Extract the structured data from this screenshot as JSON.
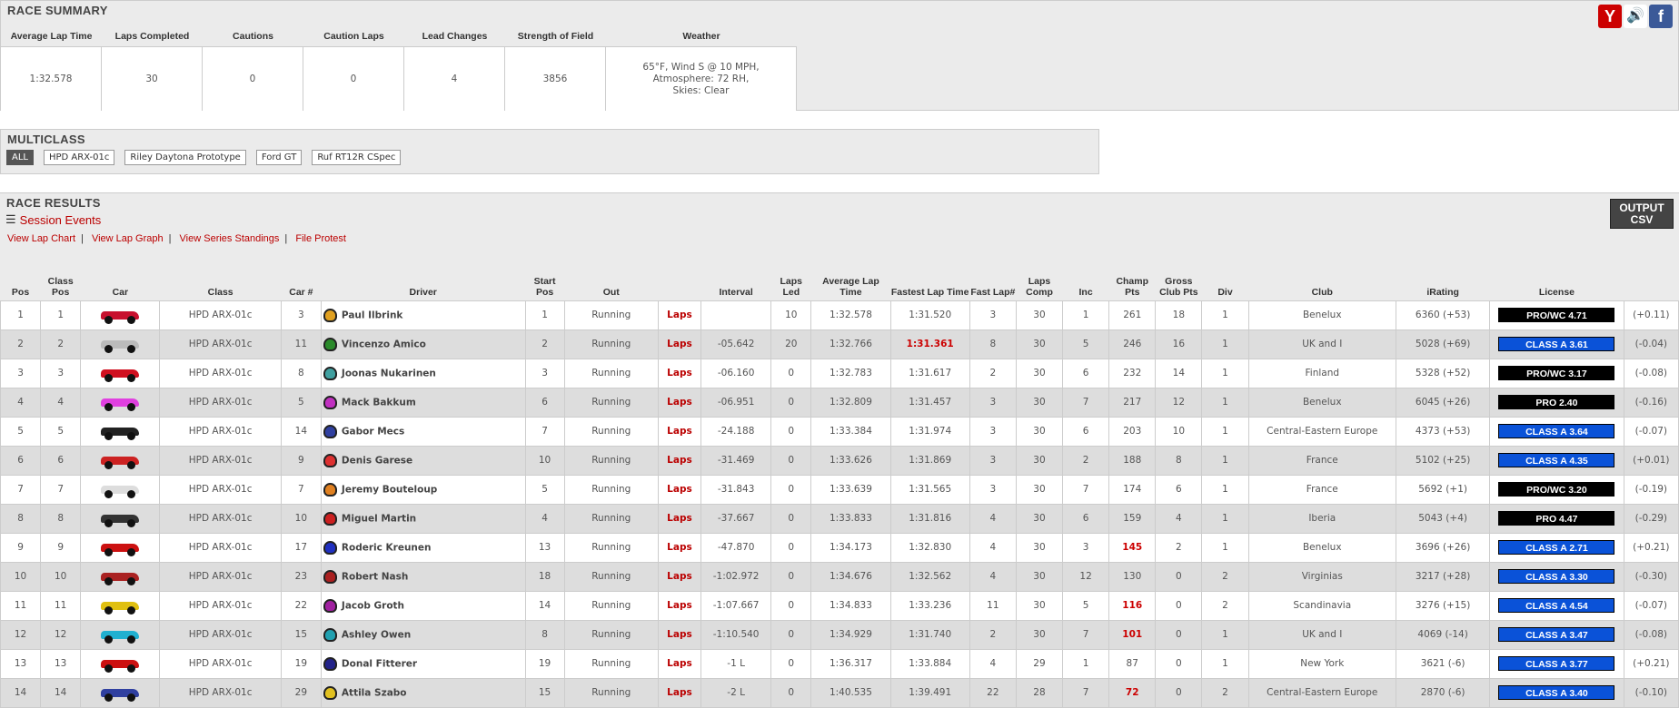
{
  "summary": {
    "title": "RACE SUMMARY",
    "headers": [
      "Average Lap Time",
      "Laps Completed",
      "Cautions",
      "Caution Laps",
      "Lead Changes",
      "Strength of Field",
      "Weather"
    ],
    "values": [
      "1:32.578",
      "30",
      "0",
      "0",
      "4",
      "3856"
    ],
    "weather": [
      "65°F, Wind S @ 10 MPH,",
      "Atmosphere: 72 RH,",
      "Skies: Clear"
    ]
  },
  "social": [
    {
      "icon": "y-icon",
      "glyph": "Y",
      "color": "#c00"
    },
    {
      "icon": "speaker-icon",
      "glyph": "🔊",
      "color": "#8899bb"
    },
    {
      "icon": "facebook-icon",
      "glyph": "f",
      "color": "#3b5998"
    }
  ],
  "multiclass": {
    "title": "MULTICLASS",
    "buttons": [
      "ALL",
      "HPD ARX-01c",
      "Riley Daytona Prototype",
      "Ford GT",
      "Ruf RT12R CSpec"
    ]
  },
  "results": {
    "title": "RACE RESULTS",
    "session_events": "Session Events",
    "links": [
      "View Lap Chart",
      "View Lap Graph",
      "View Series Standings",
      "File Protest"
    ],
    "csv_label": "OUTPUT CSV",
    "columns": [
      "Pos",
      "Class Pos",
      "Car",
      "Class",
      "Car #",
      "Driver",
      "Start Pos",
      "Out",
      "",
      "Interval",
      "Laps Led",
      "Average Lap Time",
      "Fastest Lap Time",
      "Fast Lap#",
      "Laps Comp",
      "Inc",
      "Champ Pts",
      "Gross Club Pts",
      "Div",
      "Club",
      "iRating",
      "License",
      ""
    ],
    "rows": [
      {
        "pos": "1",
        "cpos": "1",
        "cls": "HPD ARX-01c",
        "num": "3",
        "driver": "Paul Ilbrink",
        "start": "1",
        "out": "Running",
        "laps": "Laps",
        "interval": "",
        "led": "10",
        "avg": "1:32.578",
        "fast": "1:31.520",
        "fastlap": "3",
        "comp": "30",
        "inc": "1",
        "champ": "261",
        "club_pts": "18",
        "div": "1",
        "club": "Benelux",
        "irating": "6360 (+53)",
        "license": "PRO/WC 4.71",
        "lic_color": "#000",
        "sr": "(+0.11)",
        "car_color": "#c8102e",
        "helm": "#e0a020"
      },
      {
        "pos": "2",
        "cpos": "2",
        "cls": "HPD ARX-01c",
        "num": "11",
        "driver": "Vincenzo Amico",
        "start": "2",
        "out": "Running",
        "laps": "Laps",
        "interval": "-05.642",
        "led": "20",
        "avg": "1:32.766",
        "fast": "1:31.361",
        "fastlap": "8",
        "comp": "30",
        "inc": "5",
        "champ": "246",
        "club_pts": "16",
        "div": "1",
        "club": "UK and I",
        "irating": "5028 (+69)",
        "license": "CLASS A 3.61",
        "lic_color": "#0a52d8",
        "sr": "(-0.04)",
        "car_color": "#bbbbbb",
        "helm": "#2a8a2a"
      },
      {
        "pos": "3",
        "cpos": "3",
        "cls": "HPD ARX-01c",
        "num": "8",
        "driver": "Joonas Nukarinen",
        "start": "3",
        "out": "Running",
        "laps": "Laps",
        "interval": "-06.160",
        "led": "0",
        "avg": "1:32.783",
        "fast": "1:31.617",
        "fastlap": "2",
        "comp": "30",
        "inc": "6",
        "champ": "232",
        "club_pts": "14",
        "div": "1",
        "club": "Finland",
        "irating": "5328 (+52)",
        "license": "PRO/WC 3.17",
        "lic_color": "#000",
        "sr": "(-0.08)",
        "car_color": "#d01020",
        "helm": "#40a0a0"
      },
      {
        "pos": "4",
        "cpos": "4",
        "cls": "HPD ARX-01c",
        "num": "5",
        "driver": "Mack Bakkum",
        "start": "6",
        "out": "Running",
        "laps": "Laps",
        "interval": "-06.951",
        "led": "0",
        "avg": "1:32.809",
        "fast": "1:31.457",
        "fastlap": "3",
        "comp": "30",
        "inc": "7",
        "champ": "217",
        "club_pts": "12",
        "div": "1",
        "club": "Benelux",
        "irating": "6045 (+26)",
        "license": "PRO 2.40",
        "lic_color": "#000",
        "sr": "(-0.16)",
        "car_color": "#e040e0",
        "helm": "#c030c0"
      },
      {
        "pos": "5",
        "cpos": "5",
        "cls": "HPD ARX-01c",
        "num": "14",
        "driver": "Gabor Mecs",
        "start": "7",
        "out": "Running",
        "laps": "Laps",
        "interval": "-24.188",
        "led": "0",
        "avg": "1:33.384",
        "fast": "1:31.974",
        "fastlap": "3",
        "comp": "30",
        "inc": "6",
        "champ": "203",
        "club_pts": "10",
        "div": "1",
        "club": "Central-Eastern Europe",
        "irating": "4373 (+53)",
        "license": "CLASS A 3.64",
        "lic_color": "#0a52d8",
        "sr": "(-0.07)",
        "car_color": "#222222",
        "helm": "#3040a0"
      },
      {
        "pos": "6",
        "cpos": "6",
        "cls": "HPD ARX-01c",
        "num": "9",
        "driver": "Denis Garese",
        "start": "10",
        "out": "Running",
        "laps": "Laps",
        "interval": "-31.469",
        "led": "0",
        "avg": "1:33.626",
        "fast": "1:31.869",
        "fastlap": "3",
        "comp": "30",
        "inc": "2",
        "champ": "188",
        "club_pts": "8",
        "div": "1",
        "club": "France",
        "irating": "5102 (+25)",
        "license": "CLASS A 4.35",
        "lic_color": "#0a52d8",
        "sr": "(+0.01)",
        "car_color": "#cc2222",
        "helm": "#dd3030"
      },
      {
        "pos": "7",
        "cpos": "7",
        "cls": "HPD ARX-01c",
        "num": "7",
        "driver": "Jeremy Bouteloup",
        "start": "5",
        "out": "Running",
        "laps": "Laps",
        "interval": "-31.843",
        "led": "0",
        "avg": "1:33.639",
        "fast": "1:31.565",
        "fastlap": "3",
        "comp": "30",
        "inc": "7",
        "champ": "174",
        "club_pts": "6",
        "div": "1",
        "club": "France",
        "irating": "5692 (+1)",
        "license": "PRO/WC 3.20",
        "lic_color": "#000",
        "sr": "(-0.19)",
        "car_color": "#dddddd",
        "helm": "#e08020"
      },
      {
        "pos": "8",
        "cpos": "8",
        "cls": "HPD ARX-01c",
        "num": "10",
        "driver": "Miguel Martin",
        "start": "4",
        "out": "Running",
        "laps": "Laps",
        "interval": "-37.667",
        "led": "0",
        "avg": "1:33.833",
        "fast": "1:31.816",
        "fastlap": "4",
        "comp": "30",
        "inc": "6",
        "champ": "159",
        "club_pts": "4",
        "div": "1",
        "club": "Iberia",
        "irating": "5043 (+4)",
        "license": "PRO 4.47",
        "lic_color": "#000",
        "sr": "(-0.29)",
        "car_color": "#333333",
        "helm": "#cc2020"
      },
      {
        "pos": "9",
        "cpos": "9",
        "cls": "HPD ARX-01c",
        "num": "17",
        "driver": "Roderic Kreunen",
        "start": "13",
        "out": "Running",
        "laps": "Laps",
        "interval": "-47.870",
        "led": "0",
        "avg": "1:34.173",
        "fast": "1:32.830",
        "fastlap": "4",
        "comp": "30",
        "inc": "3",
        "champ": "145",
        "club_pts": "2",
        "div": "1",
        "club": "Benelux",
        "irating": "3696 (+26)",
        "license": "CLASS A 2.71",
        "lic_color": "#0a52d8",
        "sr": "(+0.21)",
        "car_color": "#cc1111",
        "helm": "#2030c0"
      },
      {
        "pos": "10",
        "cpos": "10",
        "cls": "HPD ARX-01c",
        "num": "23",
        "driver": "Robert Nash",
        "start": "18",
        "out": "Running",
        "laps": "Laps",
        "interval": "-1:02.972",
        "led": "0",
        "avg": "1:34.676",
        "fast": "1:32.562",
        "fastlap": "4",
        "comp": "30",
        "inc": "12",
        "champ": "130",
        "club_pts": "0",
        "div": "2",
        "club": "Virginias",
        "irating": "3217 (+28)",
        "license": "CLASS A 3.30",
        "lic_color": "#0a52d8",
        "sr": "(-0.30)",
        "car_color": "#aa2222",
        "helm": "#aa2020"
      },
      {
        "pos": "11",
        "cpos": "11",
        "cls": "HPD ARX-01c",
        "num": "22",
        "driver": "Jacob Groth",
        "start": "14",
        "out": "Running",
        "laps": "Laps",
        "interval": "-1:07.667",
        "led": "0",
        "avg": "1:34.833",
        "fast": "1:33.236",
        "fastlap": "11",
        "comp": "30",
        "inc": "5",
        "champ": "116",
        "club_pts": "0",
        "div": "2",
        "club": "Scandinavia",
        "irating": "3276 (+15)",
        "license": "CLASS A 4.54",
        "lic_color": "#0a52d8",
        "sr": "(-0.07)",
        "car_color": "#e0c010",
        "helm": "#a020a0"
      },
      {
        "pos": "12",
        "cpos": "12",
        "cls": "HPD ARX-01c",
        "num": "15",
        "driver": "Ashley Owen",
        "start": "8",
        "out": "Running",
        "laps": "Laps",
        "interval": "-1:10.540",
        "led": "0",
        "avg": "1:34.929",
        "fast": "1:31.740",
        "fastlap": "2",
        "comp": "30",
        "inc": "7",
        "champ": "101",
        "club_pts": "0",
        "div": "1",
        "club": "UK and I",
        "irating": "4069 (-14)",
        "license": "CLASS A 3.47",
        "lic_color": "#0a52d8",
        "sr": "(-0.08)",
        "car_color": "#20b0d0",
        "helm": "#20a0b0"
      },
      {
        "pos": "13",
        "cpos": "13",
        "cls": "HPD ARX-01c",
        "num": "19",
        "driver": "Donal Fitterer",
        "start": "19",
        "out": "Running",
        "laps": "Laps",
        "interval": "-1 L",
        "led": "0",
        "avg": "1:36.317",
        "fast": "1:33.884",
        "fastlap": "4",
        "comp": "29",
        "inc": "1",
        "champ": "87",
        "club_pts": "0",
        "div": "1",
        "club": "New York",
        "irating": "3621 (-6)",
        "license": "CLASS A 3.77",
        "lic_color": "#0a52d8",
        "sr": "(+0.21)",
        "car_color": "#cc1111",
        "helm": "#222288"
      },
      {
        "pos": "14",
        "cpos": "14",
        "cls": "HPD ARX-01c",
        "num": "29",
        "driver": "Attila Szabo",
        "start": "15",
        "out": "Running",
        "laps": "Laps",
        "interval": "-2 L",
        "led": "0",
        "avg": "1:40.535",
        "fast": "1:39.491",
        "fastlap": "22",
        "comp": "28",
        "inc": "7",
        "champ": "72",
        "club_pts": "0",
        "div": "2",
        "club": "Central-Eastern Europe",
        "irating": "2870 (-6)",
        "license": "CLASS A 3.40",
        "lic_color": "#0a52d8",
        "sr": "(-0.10)",
        "car_color": "#3040a0",
        "helm": "#e0c020"
      }
    ]
  }
}
